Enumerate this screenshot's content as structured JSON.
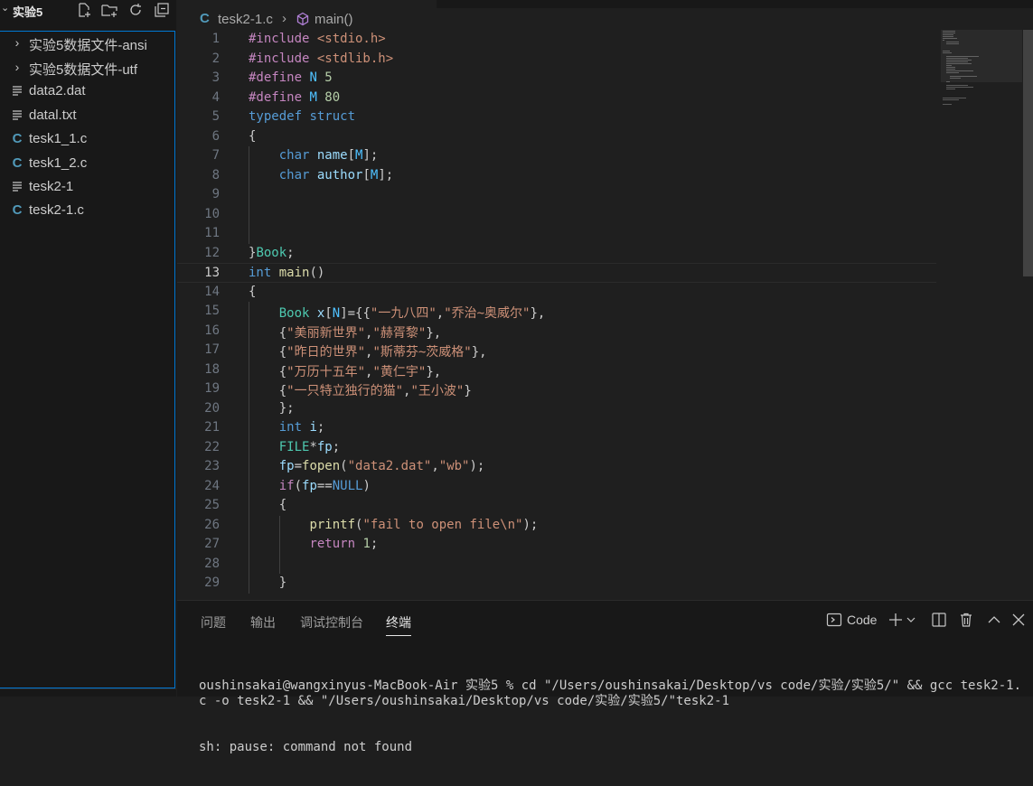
{
  "explorer": {
    "folder": "实验5",
    "items": [
      {
        "type": "folder",
        "name": "实验5数据文件-ansi"
      },
      {
        "type": "folder",
        "name": "实验5数据文件-utf"
      },
      {
        "type": "file",
        "name": "data2.dat"
      },
      {
        "type": "file",
        "name": "datal.txt"
      },
      {
        "type": "c",
        "name": "tesk1_1.c"
      },
      {
        "type": "c",
        "name": "tesk1_2.c"
      },
      {
        "type": "file",
        "name": "tesk2-1"
      },
      {
        "type": "c",
        "name": "tesk2-1.c"
      }
    ]
  },
  "editor": {
    "breadcrumb": {
      "file": "tesk2-1.c",
      "symbol": "main()"
    },
    "active_line": 13,
    "lines": [
      {
        "n": "1",
        "tokens": [
          [
            "pp",
            "#include "
          ],
          [
            "str",
            "<stdio.h>"
          ]
        ]
      },
      {
        "n": "2",
        "tokens": [
          [
            "pp",
            "#include "
          ],
          [
            "str",
            "<stdlib.h>"
          ]
        ]
      },
      {
        "n": "3",
        "tokens": [
          [
            "pp",
            "#define "
          ],
          [
            "mac",
            "N "
          ],
          [
            "num",
            "5"
          ]
        ]
      },
      {
        "n": "4",
        "tokens": [
          [
            "pp",
            "#define "
          ],
          [
            "mac",
            "M "
          ],
          [
            "num",
            "80"
          ]
        ]
      },
      {
        "n": "5",
        "tokens": [
          [
            "kw",
            "typedef "
          ],
          [
            "kw",
            "struct"
          ]
        ]
      },
      {
        "n": "6",
        "tokens": [
          [
            "p",
            "{"
          ]
        ]
      },
      {
        "n": "7",
        "tokens": [
          [
            "p",
            "    "
          ],
          [
            "kw",
            "char "
          ],
          [
            "var",
            "name"
          ],
          [
            "p",
            "["
          ],
          [
            "mac",
            "M"
          ],
          [
            "p",
            "];"
          ]
        ]
      },
      {
        "n": "8",
        "tokens": [
          [
            "p",
            "    "
          ],
          [
            "kw",
            "char "
          ],
          [
            "var",
            "author"
          ],
          [
            "p",
            "["
          ],
          [
            "mac",
            "M"
          ],
          [
            "p",
            "];"
          ]
        ]
      },
      {
        "n": "9",
        "tokens": []
      },
      {
        "n": "10",
        "tokens": []
      },
      {
        "n": "11",
        "tokens": []
      },
      {
        "n": "12",
        "tokens": [
          [
            "p",
            "}"
          ],
          [
            "ty",
            "Book"
          ],
          [
            "p",
            ";"
          ]
        ]
      },
      {
        "n": "13",
        "tokens": [
          [
            "kw",
            "int "
          ],
          [
            "fn",
            "main"
          ],
          [
            "p",
            "()"
          ]
        ]
      },
      {
        "n": "14",
        "tokens": [
          [
            "p",
            "{"
          ]
        ]
      },
      {
        "n": "15",
        "tokens": [
          [
            "p",
            "    "
          ],
          [
            "ty",
            "Book "
          ],
          [
            "var",
            "x"
          ],
          [
            "p",
            "["
          ],
          [
            "mac",
            "N"
          ],
          [
            "p",
            "]={{"
          ],
          [
            "str",
            "\"一九八四\""
          ],
          [
            "p",
            ","
          ],
          [
            "str",
            "\"乔治~奥威尔\""
          ],
          [
            "p",
            "},"
          ]
        ]
      },
      {
        "n": "16",
        "tokens": [
          [
            "p",
            "    {"
          ],
          [
            "str",
            "\"美丽新世界\""
          ],
          [
            "p",
            ","
          ],
          [
            "str",
            "\"赫胥黎\""
          ],
          [
            "p",
            "},"
          ]
        ]
      },
      {
        "n": "17",
        "tokens": [
          [
            "p",
            "    {"
          ],
          [
            "str",
            "\"昨日的世界\""
          ],
          [
            "p",
            ","
          ],
          [
            "str",
            "\"斯蒂芬~茨威格\""
          ],
          [
            "p",
            "},"
          ]
        ]
      },
      {
        "n": "18",
        "tokens": [
          [
            "p",
            "    {"
          ],
          [
            "str",
            "\"万历十五年\""
          ],
          [
            "p",
            ","
          ],
          [
            "str",
            "\"黄仁宇\""
          ],
          [
            "p",
            "},"
          ]
        ]
      },
      {
        "n": "19",
        "tokens": [
          [
            "p",
            "    {"
          ],
          [
            "str",
            "\"一只特立独行的猫\""
          ],
          [
            "p",
            ","
          ],
          [
            "str",
            "\"王小波\""
          ],
          [
            "p",
            "}"
          ]
        ]
      },
      {
        "n": "20",
        "tokens": [
          [
            "p",
            "    };"
          ]
        ]
      },
      {
        "n": "21",
        "tokens": [
          [
            "p",
            "    "
          ],
          [
            "kw",
            "int "
          ],
          [
            "var",
            "i"
          ],
          [
            "p",
            ";"
          ]
        ]
      },
      {
        "n": "22",
        "tokens": [
          [
            "p",
            "    "
          ],
          [
            "ty",
            "FILE"
          ],
          [
            "p",
            "*"
          ],
          [
            "var",
            "fp"
          ],
          [
            "p",
            ";"
          ]
        ]
      },
      {
        "n": "23",
        "tokens": [
          [
            "p",
            "    "
          ],
          [
            "var",
            "fp"
          ],
          [
            "p",
            "="
          ],
          [
            "fn",
            "fopen"
          ],
          [
            "p",
            "("
          ],
          [
            "str",
            "\"data2.dat\""
          ],
          [
            "p",
            ","
          ],
          [
            "str",
            "\"wb\""
          ],
          [
            "p",
            ");"
          ]
        ]
      },
      {
        "n": "24",
        "tokens": [
          [
            "p",
            "    "
          ],
          [
            "ctl",
            "if"
          ],
          [
            "p",
            "("
          ],
          [
            "var",
            "fp"
          ],
          [
            "p",
            "=="
          ],
          [
            "const",
            "NULL"
          ],
          [
            "p",
            ")"
          ]
        ]
      },
      {
        "n": "25",
        "tokens": [
          [
            "p",
            "    {"
          ]
        ]
      },
      {
        "n": "26",
        "tokens": [
          [
            "p",
            "        "
          ],
          [
            "fn",
            "printf"
          ],
          [
            "p",
            "("
          ],
          [
            "str",
            "\"fail to open file\\n\""
          ],
          [
            "p",
            ");"
          ]
        ]
      },
      {
        "n": "27",
        "tokens": [
          [
            "p",
            "        "
          ],
          [
            "ctl",
            "return "
          ],
          [
            "num",
            "1"
          ],
          [
            "p",
            ";"
          ]
        ]
      },
      {
        "n": "28",
        "tokens": []
      },
      {
        "n": "29",
        "tokens": [
          [
            "p",
            "    }"
          ]
        ]
      }
    ]
  },
  "panel": {
    "tabs": [
      "问题",
      "输出",
      "调试控制台",
      "终端"
    ],
    "active_tab": 3,
    "terminal_name": "Code",
    "terminal_lines": [
      "oushinsakai@wangxinyus-MacBook-Air 实验5 % cd \"/Users/oushinsakai/Desktop/vs code/实验/实验5/\" && gcc tesk2-1.c -o tesk2-1 && \"/Users/oushinsakai/Desktop/vs code/实验/实验5/\"tesk2-1",
      "sh: pause: command not found"
    ]
  },
  "colors": {
    "accent": "#0078d4",
    "c_file_icon": "#519aba",
    "editor_bg": "#1f1f1f",
    "sidebar_bg": "#181818"
  }
}
